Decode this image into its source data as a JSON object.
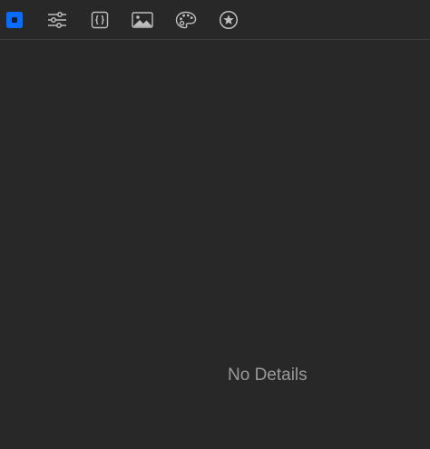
{
  "toolbar": {
    "tabs": [
      {
        "icon": "selected-element-icon",
        "active": true
      },
      {
        "icon": "sliders-icon",
        "active": false
      },
      {
        "icon": "code-braces-icon",
        "active": false
      },
      {
        "icon": "image-icon",
        "active": false
      },
      {
        "icon": "palette-icon",
        "active": false
      },
      {
        "icon": "star-circle-icon",
        "active": false
      }
    ]
  },
  "content": {
    "empty_message": "No Details"
  },
  "colors": {
    "background": "#282828",
    "accent": "#0a6cff",
    "icon": "#bdbdbd",
    "divider": "#3d3d3d",
    "muted_text": "#9a9a9a"
  }
}
